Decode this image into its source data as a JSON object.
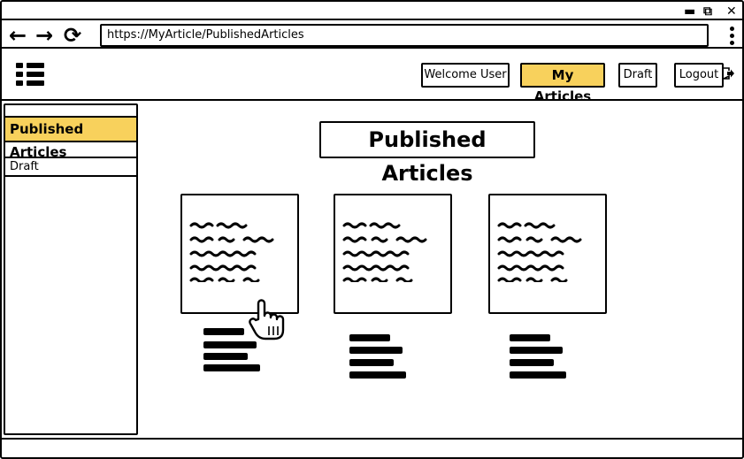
{
  "window": {
    "controls": {
      "minimize": "▬",
      "restore": "⧉",
      "close": "✕"
    }
  },
  "browser": {
    "back_icon": "←",
    "forward_icon": "→",
    "reload_icon": "⟳",
    "url": "https://MyArticle/PublishedArticles"
  },
  "header": {
    "menu_icon": "hamburger-list-icon",
    "welcome_label": "Welcome User",
    "my_articles_label": "My Articles",
    "draft_label": "Draft",
    "logout_label": "Logout"
  },
  "sidebar": {
    "items": [
      {
        "label": "Published Articles",
        "active": true
      },
      {
        "label": "Draft",
        "active": false
      }
    ]
  },
  "main": {
    "title": "Published Articles",
    "articles": [
      {
        "preview_lines": 5
      },
      {
        "preview_lines": 5
      },
      {
        "preview_lines": 5
      }
    ]
  },
  "colors": {
    "accent": "#f8d15c",
    "border": "#000000",
    "background": "#ffffff"
  }
}
